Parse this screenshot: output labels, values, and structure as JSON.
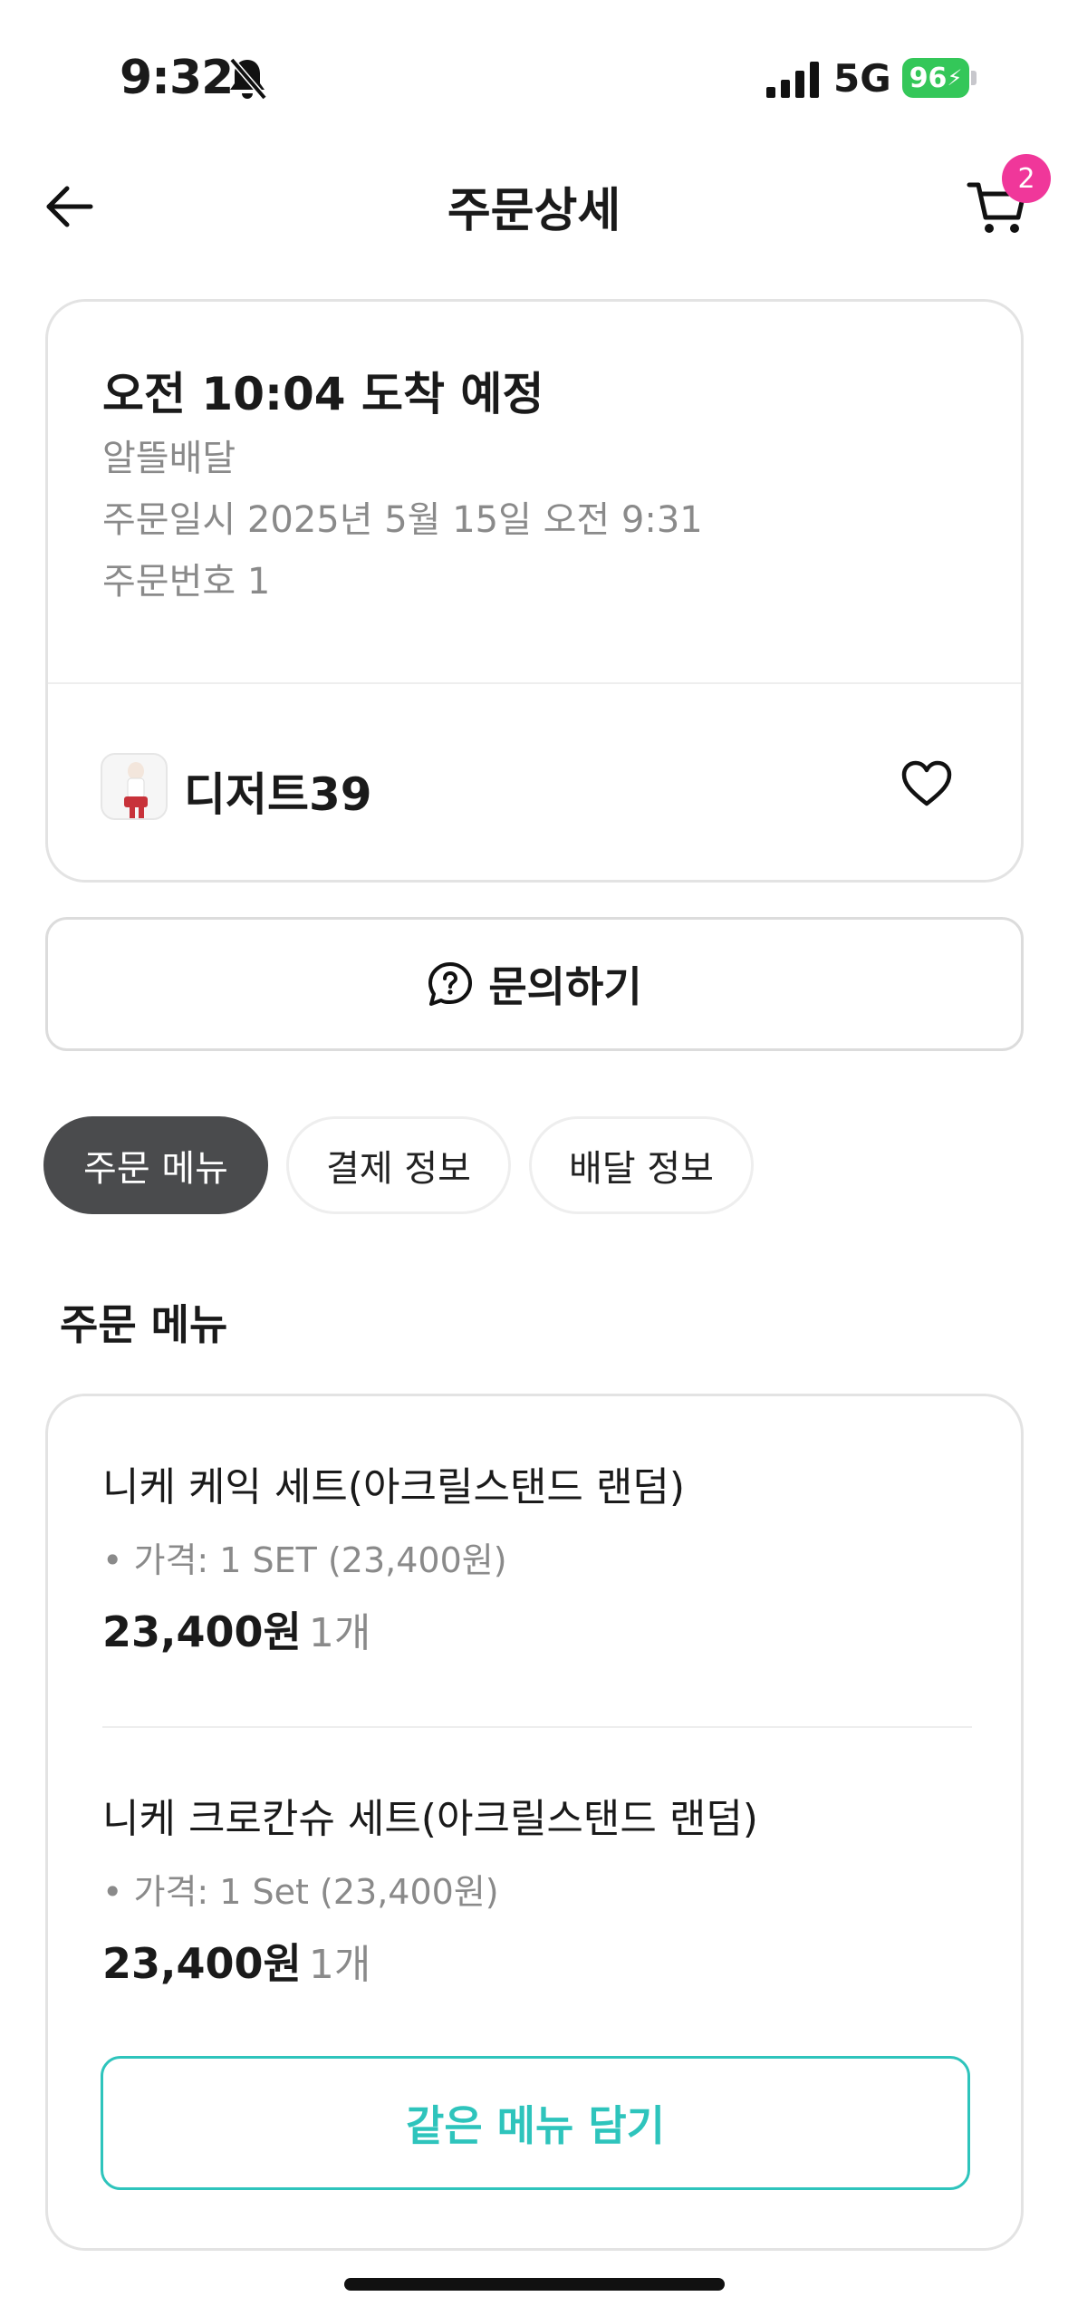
{
  "status_bar": {
    "time": "9:32",
    "network": "5G",
    "battery": "96"
  },
  "nav": {
    "title": "주문상세",
    "cart_count": "2"
  },
  "order": {
    "arrival": "오전 10:04 도착 예정",
    "delivery_type": "알뜰배달",
    "order_datetime": "주문일시 2025년 5월 15일 오전 9:31",
    "order_number": "주문번호 1",
    "store_name": "디저트39"
  },
  "inquiry": {
    "label": "문의하기"
  },
  "tabs": [
    {
      "label": "주문 메뉴",
      "active": true
    },
    {
      "label": "결제 정보",
      "active": false
    },
    {
      "label": "배달 정보",
      "active": false
    }
  ],
  "section": {
    "title": "주문 메뉴"
  },
  "items": [
    {
      "name": "니케 케익 세트(아크릴스탠드 랜덤)",
      "option": "• 가격: 1 SET (23,400원)",
      "price": "23,400원",
      "qty": "1개"
    },
    {
      "name": "니케 크로칸슈 세트(아크릴스탠드 랜덤)",
      "option": "• 가격: 1 Set (23,400원)",
      "price": "23,400원",
      "qty": "1개"
    }
  ],
  "reorder": {
    "label": "같은 메뉴 담기"
  },
  "colors": {
    "accent": "#2ec4bc",
    "badge": "#f0379a",
    "active_tab": "#4a4b4d",
    "battery": "#34c759"
  }
}
